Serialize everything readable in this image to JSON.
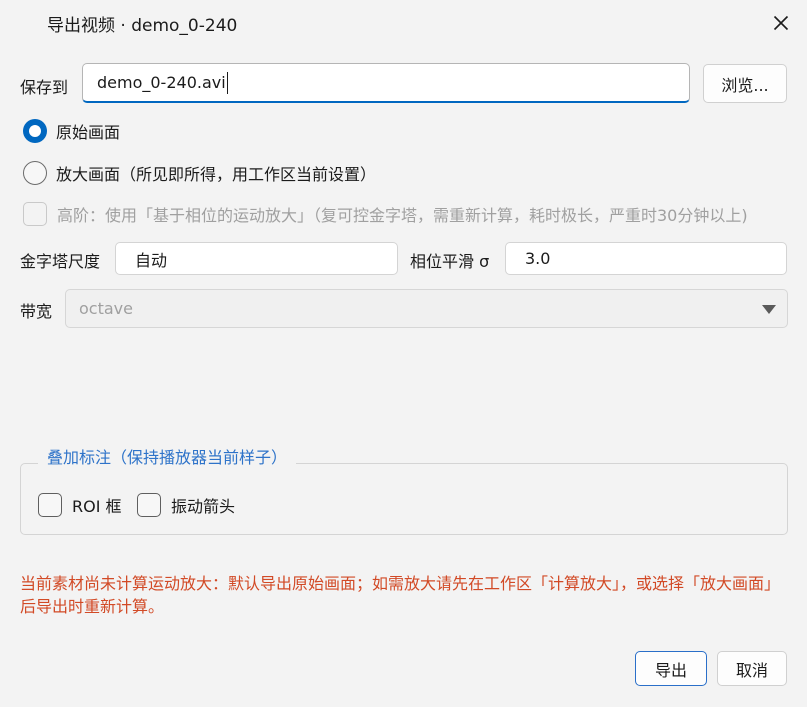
{
  "window": {
    "title": "导出视频 · demo_0-240"
  },
  "save": {
    "label": "保存到",
    "value": "demo_0-240.avi",
    "browse_label": "浏览..."
  },
  "mode": {
    "options": [
      {
        "label": "原始画面",
        "checked": true
      },
      {
        "label": "放大画面（所见即所得，用工作区当前设置）",
        "checked": false
      }
    ]
  },
  "advanced": {
    "label": "高阶：使用「基于相位的运动放大」（复可控金字塔，需重新计算，耗时极长，严重时30分钟以上)",
    "checked": false,
    "enabled": false
  },
  "pyramid": {
    "label": "金字塔尺度",
    "value": "自动"
  },
  "phase": {
    "label": "相位平滑 σ",
    "value": "3.0"
  },
  "bandwidth": {
    "label": "带宽",
    "selected": "octave"
  },
  "overlay": {
    "title": "叠加标注（保持播放器当前样子）",
    "options": [
      {
        "label": "ROI 框",
        "checked": false
      },
      {
        "label": "振动箭头",
        "checked": false
      }
    ]
  },
  "warning": "当前素材尚未计算运动放大：默认导出原始画面；如需放大请先在工作区「计算放大」，或选择「放大画面」后导出时重新计算。",
  "actions": {
    "export_label": "导出",
    "cancel_label": "取消"
  },
  "colors": {
    "accent": "#0067c0",
    "warning": "#d24a26",
    "group_title": "#2e73c9"
  }
}
